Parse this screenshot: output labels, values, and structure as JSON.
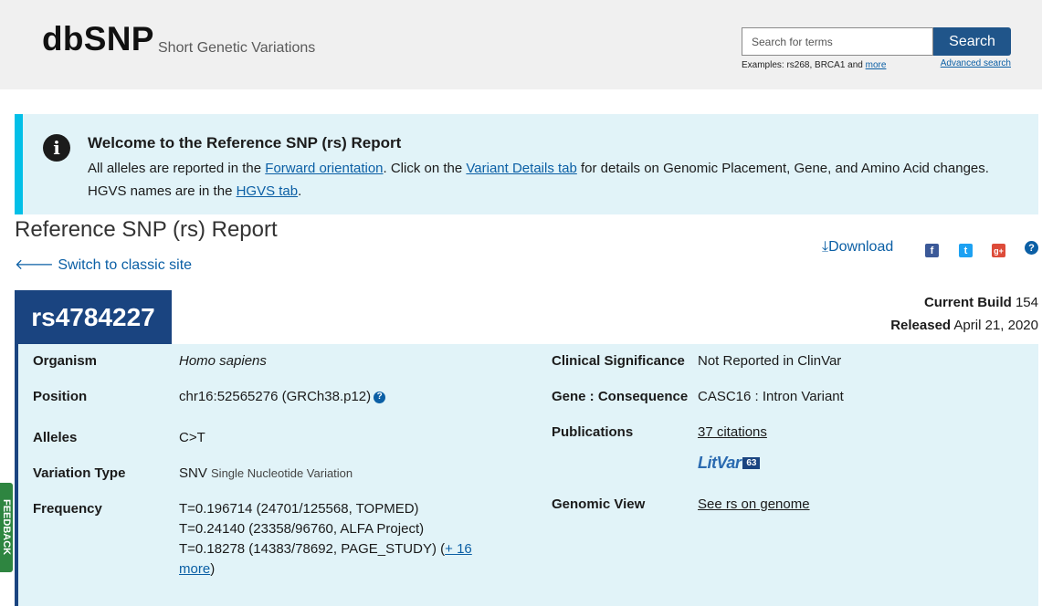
{
  "header": {
    "logo": "dbSNP",
    "tagline": "Short Genetic Variations",
    "search_placeholder": "Search for terms",
    "search_button": "Search",
    "examples_prefix": "Examples: rs268, BRCA1 and ",
    "examples_more": "more",
    "advanced_search": "Advanced search"
  },
  "banner": {
    "title": "Welcome to the Reference SNP (rs) Report",
    "text_1": "All alleles are reported in the ",
    "link_forward": "Forward orientation",
    "text_2": ". Click on the ",
    "link_variant": "Variant Details tab",
    "text_3": " for details on Genomic Placement, Gene, and Amino Acid changes. HGVS names are in the ",
    "link_hgvs": "HGVS tab",
    "text_4": "."
  },
  "page": {
    "title": "Reference SNP (rs) Report",
    "classic_link": "Switch to classic site",
    "download": "Download"
  },
  "rs": {
    "id": "rs4784227",
    "current_build_label": "Current Build",
    "current_build_value": "154",
    "released_label": "Released",
    "released_value": "April 21, 2020"
  },
  "summary": {
    "organism_label": "Organism",
    "organism_value": "Homo sapiens",
    "position_label": "Position",
    "position_value": "chr16:52565276 (GRCh38.p12)",
    "alleles_label": "Alleles",
    "alleles_value": "C>T",
    "variation_type_label": "Variation Type",
    "variation_type_value": "SNV",
    "variation_type_desc": "Single Nucleotide Variation",
    "frequency_label": "Frequency",
    "frequency_1": "T=0.196714 (24701/125568, TOPMED)",
    "frequency_2": "T=0.24140 (23358/96760, ALFA Project)",
    "frequency_3": "T=0.18278 (14383/78692, PAGE_STUDY) (",
    "frequency_more": "+ 16 more",
    "frequency_close": ")",
    "clinical_label": "Clinical Significance",
    "clinical_value": "Not Reported in ClinVar",
    "gene_label": "Gene : Consequence",
    "gene_value": "CASC16 : Intron Variant",
    "publications_label": "Publications",
    "publications_value": "37 citations",
    "litvar_label": "LitVar",
    "litvar_count": "63",
    "genomic_view_label": "Genomic View",
    "genomic_view_value": "See rs on genome"
  },
  "feedback": "FEEDBACK"
}
